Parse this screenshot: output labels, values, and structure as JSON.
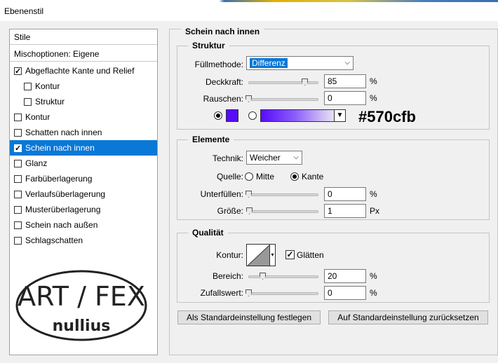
{
  "window": {
    "title": "Ebenenstil"
  },
  "styles_panel": {
    "header": "Stile",
    "blend_options": "Mischoptionen: Eigene",
    "items": [
      {
        "label": "Abgeflachte Kante und Relief",
        "checked": true,
        "indent": false,
        "selected": false
      },
      {
        "label": "Kontur",
        "checked": false,
        "indent": true,
        "selected": false
      },
      {
        "label": "Struktur",
        "checked": false,
        "indent": true,
        "selected": false
      },
      {
        "label": "Kontur",
        "checked": false,
        "indent": false,
        "selected": false
      },
      {
        "label": "Schatten nach innen",
        "checked": false,
        "indent": false,
        "selected": false
      },
      {
        "label": "Schein nach innen",
        "checked": true,
        "indent": false,
        "selected": true
      },
      {
        "label": "Glanz",
        "checked": false,
        "indent": false,
        "selected": false
      },
      {
        "label": "Farbüberlagerung",
        "checked": false,
        "indent": false,
        "selected": false
      },
      {
        "label": "Verlaufsüberlagerung",
        "checked": false,
        "indent": false,
        "selected": false
      },
      {
        "label": "Musterüberlagerung",
        "checked": false,
        "indent": false,
        "selected": false
      },
      {
        "label": "Schein nach außen",
        "checked": false,
        "indent": false,
        "selected": false
      },
      {
        "label": "Schlagschatten",
        "checked": false,
        "indent": false,
        "selected": false
      }
    ]
  },
  "logo": {
    "top_text": "ART / FEX",
    "bottom_text": "nullius"
  },
  "main": {
    "title": "Schein nach innen",
    "structure": {
      "legend": "Struktur",
      "blend_mode_label": "Füllmethode:",
      "blend_mode_value": "Differenz",
      "opacity_label": "Deckkraft:",
      "opacity_value": "85",
      "opacity_unit": "%",
      "opacity_level": 0.85,
      "noise_label": "Rauschen:",
      "noise_value": "0",
      "noise_unit": "%",
      "noise_level": 0,
      "color_hex": "#570cfb",
      "color_label": "#570cfb",
      "color_mode": "solid"
    },
    "elements": {
      "legend": "Elemente",
      "technique_label": "Technik:",
      "technique_value": "Weicher",
      "source_label": "Quelle:",
      "source_options": [
        "Mitte",
        "Kante"
      ],
      "source_selected": "Kante",
      "choke_label": "Unterfüllen:",
      "choke_value": "0",
      "choke_unit": "%",
      "choke_level": 0,
      "size_label": "Größe:",
      "size_value": "1",
      "size_unit": "Px",
      "size_level": 0.01
    },
    "quality": {
      "legend": "Qualität",
      "contour_label": "Kontur:",
      "antialias_label": "Glätten",
      "antialias_checked": true,
      "range_label": "Bereich:",
      "range_value": "20",
      "range_unit": "%",
      "range_level": 0.2,
      "jitter_label": "Zufallswert:",
      "jitter_value": "0",
      "jitter_unit": "%",
      "jitter_level": 0
    },
    "buttons": {
      "make_default": "Als Standardeinstellung festlegen",
      "reset_default": "Auf Standardeinstellung zurücksetzen"
    }
  }
}
